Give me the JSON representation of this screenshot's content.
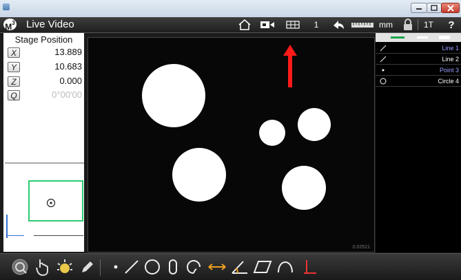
{
  "window": {
    "title": ""
  },
  "toolbar": {
    "logo_text": "M",
    "logo_sup": "3",
    "title": "Live Video",
    "count_label": "1",
    "unit_label": "mm",
    "mode_label": "1T",
    "help_label": "?"
  },
  "stage": {
    "title": "Stage Position",
    "axes": [
      {
        "label": "X",
        "value": "13.889"
      },
      {
        "label": "Y",
        "value": "10.683"
      },
      {
        "label": "Z",
        "value": "0.000"
      },
      {
        "label": "Q",
        "value": "0°00'00"
      }
    ]
  },
  "video": {
    "stamp": "0.02521"
  },
  "features": [
    {
      "icon": "line-icon",
      "label": "Line 1",
      "color": "#9aa0ff"
    },
    {
      "icon": "line-icon",
      "label": "Line 2",
      "color": "#ffffff"
    },
    {
      "icon": "point-icon",
      "label": "Point 3",
      "color": "#9aa0ff"
    },
    {
      "icon": "circle-icon",
      "label": "Circle 4",
      "color": "#ffffff"
    }
  ],
  "colors": {
    "annotation_arrow": "#ff1a1a",
    "preview_frame": "#2ecc71",
    "tab_green": "#16a34a"
  }
}
